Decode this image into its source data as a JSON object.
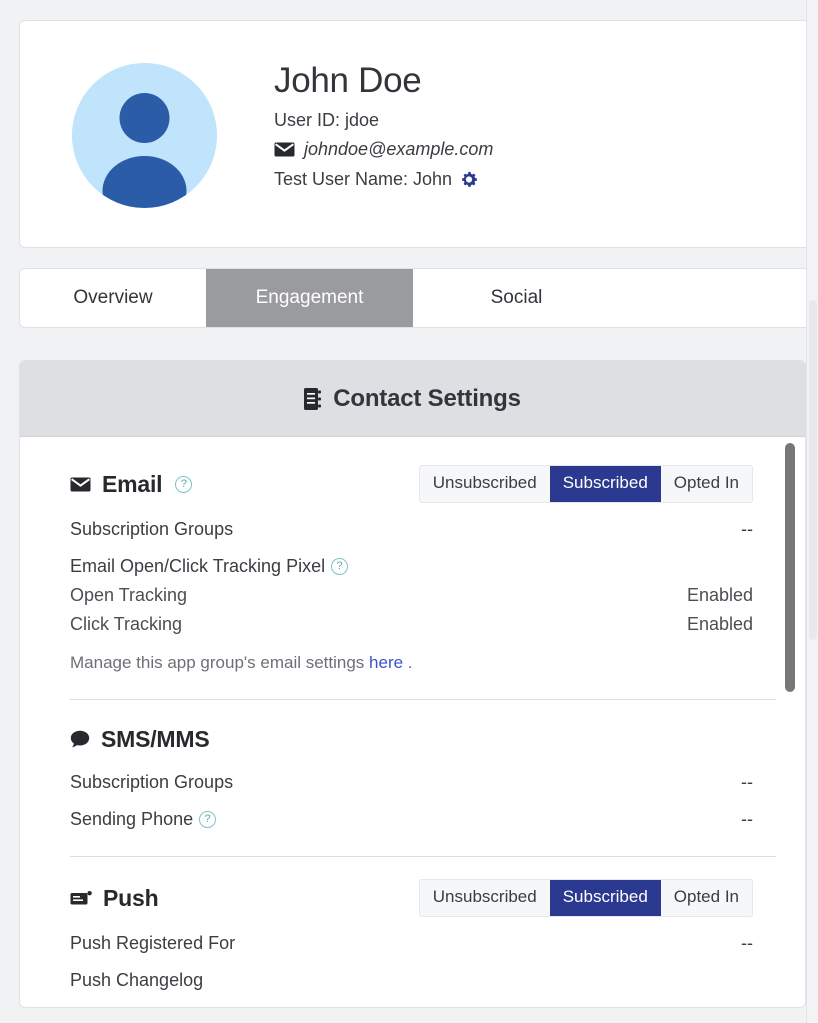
{
  "profile": {
    "name": "John Doe",
    "user_id_label": "User ID: jdoe",
    "email": "johndoe@example.com",
    "test_user_name": "Test User Name: John",
    "avatar_bg": "#bfe4fb",
    "avatar_fg": "#2b5ca8",
    "email_icon": "envelope-icon",
    "settings_icon": "gear-icon",
    "settings_icon_color": "#2b3a8f"
  },
  "tabs": [
    {
      "label": "Overview",
      "active": false
    },
    {
      "label": "Engagement",
      "active": true
    },
    {
      "label": "Social",
      "active": false
    }
  ],
  "panel": {
    "header_icon": "address-book-icon",
    "header_title": "Contact Settings",
    "accent_color": "#2b3990",
    "link_color": "#3a55c9",
    "help_color": "#5aa8b0"
  },
  "segmented_options": [
    "Unsubscribed",
    "Subscribed",
    "Opted In"
  ],
  "channels": {
    "email": {
      "icon": "envelope-icon",
      "title": "Email",
      "help": "?",
      "selected_status": "Subscribed",
      "rows": [
        {
          "label": "Subscription Groups",
          "value": "--",
          "help": false
        },
        {
          "label": "Email Open/Click Tracking Pixel",
          "value": "",
          "help": true
        }
      ],
      "sub_rows": [
        {
          "label": "Open Tracking",
          "value": "Enabled"
        },
        {
          "label": "Click Tracking",
          "value": "Enabled"
        }
      ],
      "note_prefix": "Manage this app group's email settings ",
      "note_link": "here",
      "note_suffix": " ."
    },
    "sms": {
      "icon": "comment-icon",
      "title": "SMS/MMS",
      "rows": [
        {
          "label": "Subscription Groups",
          "value": "--",
          "help": false
        },
        {
          "label": "Sending Phone",
          "value": "--",
          "help": true
        }
      ]
    },
    "push": {
      "icon": "push-card-icon",
      "title": "Push",
      "selected_status": "Subscribed",
      "rows": [
        {
          "label": "Push Registered For",
          "value": "--",
          "help": false
        },
        {
          "label": "Push Changelog",
          "value": "",
          "help": false
        }
      ]
    }
  }
}
